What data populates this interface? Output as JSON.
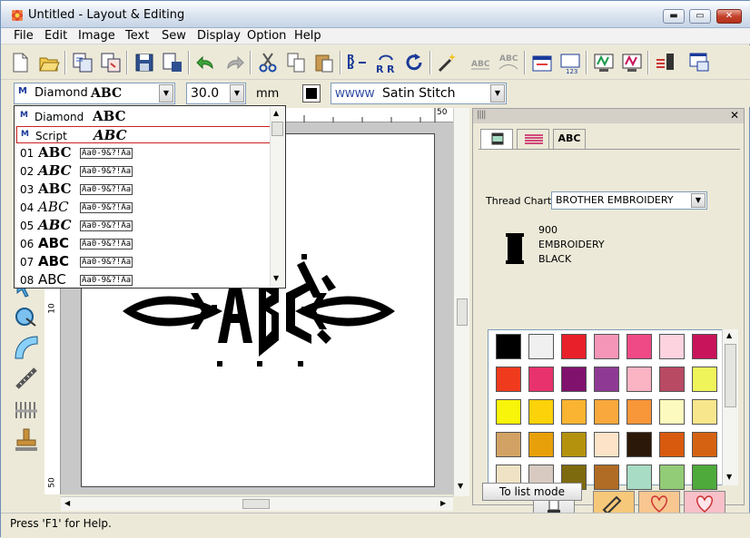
{
  "window": {
    "title": "Untitled - Layout & Editing",
    "min_label": "▬",
    "max_label": "▭",
    "close_label": "✕"
  },
  "menu": {
    "items": [
      "File",
      "Edit",
      "Image",
      "Text",
      "Sew",
      "Display",
      "Option",
      "Help"
    ]
  },
  "toolbar2": {
    "font_selected": "Diamond",
    "font_sample": "ABC",
    "size_value": "30.0",
    "unit": "mm",
    "stitch_type": "Satin Stitch"
  },
  "font_list": {
    "items": [
      {
        "num": "",
        "name": "Diamond",
        "sample": "ABC",
        "chars": "",
        "selected": false
      },
      {
        "num": "",
        "name": "Script",
        "sample": "ABC",
        "chars": "",
        "selected": true
      },
      {
        "num": "01",
        "name": "",
        "sample": "ABC",
        "chars": "Aa0-9&?!Aa"
      },
      {
        "num": "02",
        "name": "",
        "sample": "ABC",
        "chars": "Aa0-9&?!Aa"
      },
      {
        "num": "03",
        "name": "",
        "sample": "ABC",
        "chars": "Aa0-9&?!Aa"
      },
      {
        "num": "04",
        "name": "",
        "sample": "ABC",
        "chars": "Aa0-9&?!Aa"
      },
      {
        "num": "05",
        "name": "",
        "sample": "ABC",
        "chars": "Aa0-9&?!Aa"
      },
      {
        "num": "06",
        "name": "",
        "sample": "ABC",
        "chars": "Aa0-9&?!Aa"
      },
      {
        "num": "07",
        "name": "",
        "sample": "ABC",
        "chars": "Aa0-9&?!Aa"
      },
      {
        "num": "08",
        "name": "",
        "sample": "ABC",
        "chars": "Aa0-9&?!Aa"
      }
    ]
  },
  "ruler": {
    "top_label": "50",
    "left_labels": [
      "10",
      "50"
    ]
  },
  "panel": {
    "tabs": [
      "",
      "",
      "ABC"
    ],
    "thread_chart_label": "Thread Chart:",
    "thread_chart_value": "BROTHER EMBROIDERY",
    "thread_number": "900",
    "thread_name_line1": "EMBROIDERY",
    "thread_name_line2": "BLACK",
    "list_mode_button": "To list mode",
    "colors": [
      "#000000",
      "#f0f0f0",
      "#e8202a",
      "#f596b8",
      "#ef4a86",
      "#fcd3df",
      "#c8145a",
      "#f03a1e",
      "#e8326e",
      "#80126e",
      "#8e3a94",
      "#fbb4c4",
      "#b84a64",
      "#eef45a",
      "#f8f40a",
      "#fcd20a",
      "#fab432",
      "#f8a83c",
      "#f8963a",
      "#fcfabe",
      "#f8e68c",
      "#d2a264",
      "#e8a00a",
      "#b4920e",
      "#fde4c8",
      "#2c1808",
      "#d85a0e",
      "#d46212",
      "#f0e2c4",
      "#d8cac0",
      "#7e6a0e",
      "#b06c24",
      "#a8dcc4",
      "#92cc76",
      "#4eaa3a"
    ]
  },
  "status": {
    "text": "Press 'F1' for Help."
  }
}
